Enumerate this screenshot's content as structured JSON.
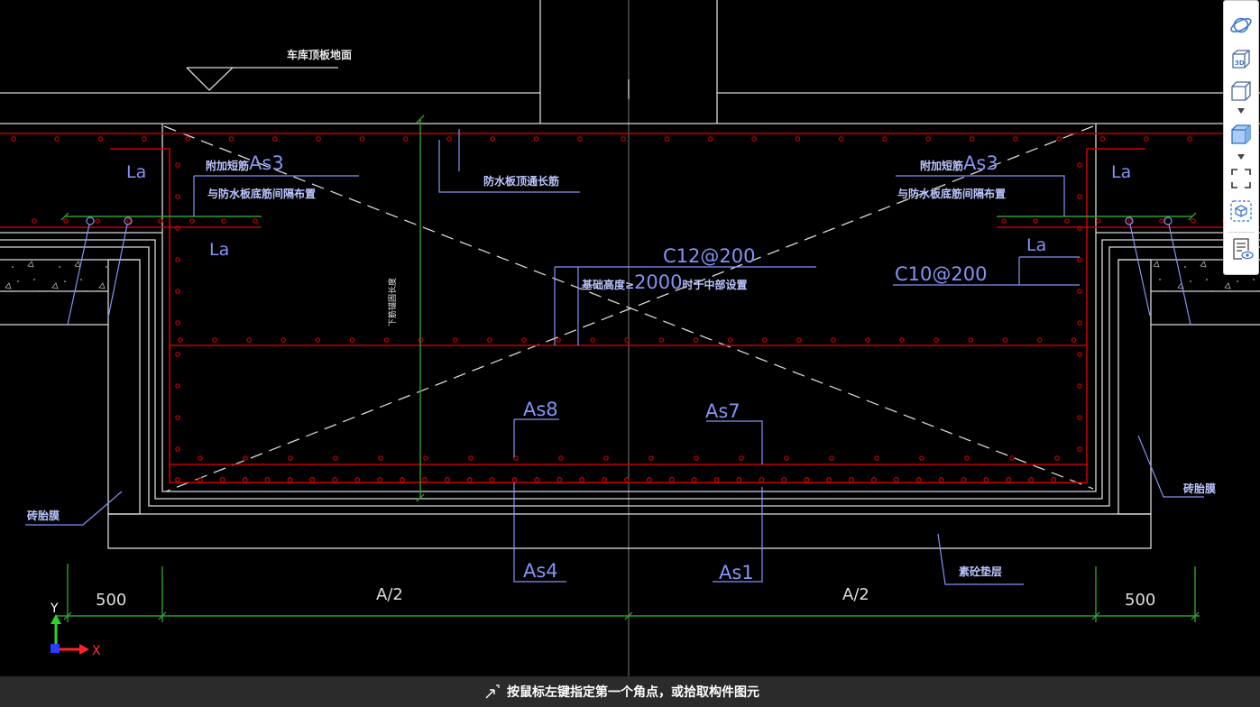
{
  "colors": {
    "canvas": "#000000",
    "line": "#d9d9d9",
    "rebar": "#c80000",
    "dimension": "#2e9e2e",
    "label": "#8494f5",
    "label_note": "#bcc6ff",
    "center_line": "#7a7a7a",
    "status_bar": "#2b2b2b",
    "toolbar_icon": "#3b78c9"
  },
  "toolbar": {
    "buttons": [
      {
        "icon": "orbit-icon"
      },
      {
        "icon": "cube-3d-icon",
        "label": "3D"
      },
      {
        "icon": "wireframe-cube-icon",
        "has_dropdown": true
      },
      {
        "icon": "shaded-cube-icon",
        "has_dropdown": true
      },
      {
        "icon": "zoom-extents-icon"
      },
      {
        "icon": "dashed-cube-icon"
      },
      {
        "icon": "document-eye-icon"
      }
    ]
  },
  "drawing": {
    "ground_label": "车库顶板地面",
    "la": [
      "La",
      "La",
      "La",
      "La"
    ],
    "as3_left": {
      "prefix": "附加短筋",
      "code": "As3",
      "note": "与防水板底筋间隔布置"
    },
    "as3_right": {
      "prefix": "附加短筋",
      "code": "As3",
      "note": "与防水板底筋间隔布置"
    },
    "top_bar_note": "防水板顶通长筋",
    "mid_bar": {
      "code": "C12@200",
      "prefix": "基础高度≥",
      "value": "2000",
      "suffix": "时于中部设置"
    },
    "side_bar": "C10@200",
    "bars": {
      "as8": "As8",
      "as7": "As7",
      "as4": "As4",
      "as1": "As1"
    },
    "brick_mold": [
      "砖胎膜",
      "砖胎膜"
    ],
    "cushion": "素砼垫层",
    "anchor_note": "下筋锚固长度"
  },
  "dimensions": [
    "500",
    "A/2",
    "A/2",
    "500"
  ],
  "axes": {
    "x": "X",
    "y": "Y"
  },
  "status_bar": {
    "prompt": "按鼠标左键指定第一个角点，或拾取构件图元",
    "icon": "pick-cursor-icon"
  }
}
